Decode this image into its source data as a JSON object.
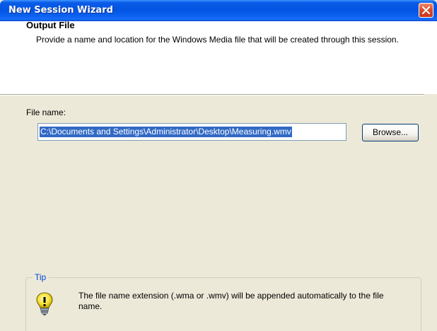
{
  "window": {
    "title": "New Session Wizard"
  },
  "header": {
    "title": "Output File",
    "description": "Provide a name and location for the Windows Media file that will be created through this session."
  },
  "file_name": {
    "label": "File name:",
    "value": "C:\\Documents and Settings\\Administrator\\Desktop\\Measuring.wmv",
    "browse_label": "Browse..."
  },
  "tip": {
    "legend": "Tip",
    "icon": "lightbulb-tip-icon",
    "text": "The file name extension (.wma or .wmv) will be appended automatically to the file name."
  },
  "colors": {
    "titlebar": "#0454e3",
    "selection": "#316ac5",
    "tip_legend": "#0046d5",
    "close_button": "#dc4e2a"
  }
}
